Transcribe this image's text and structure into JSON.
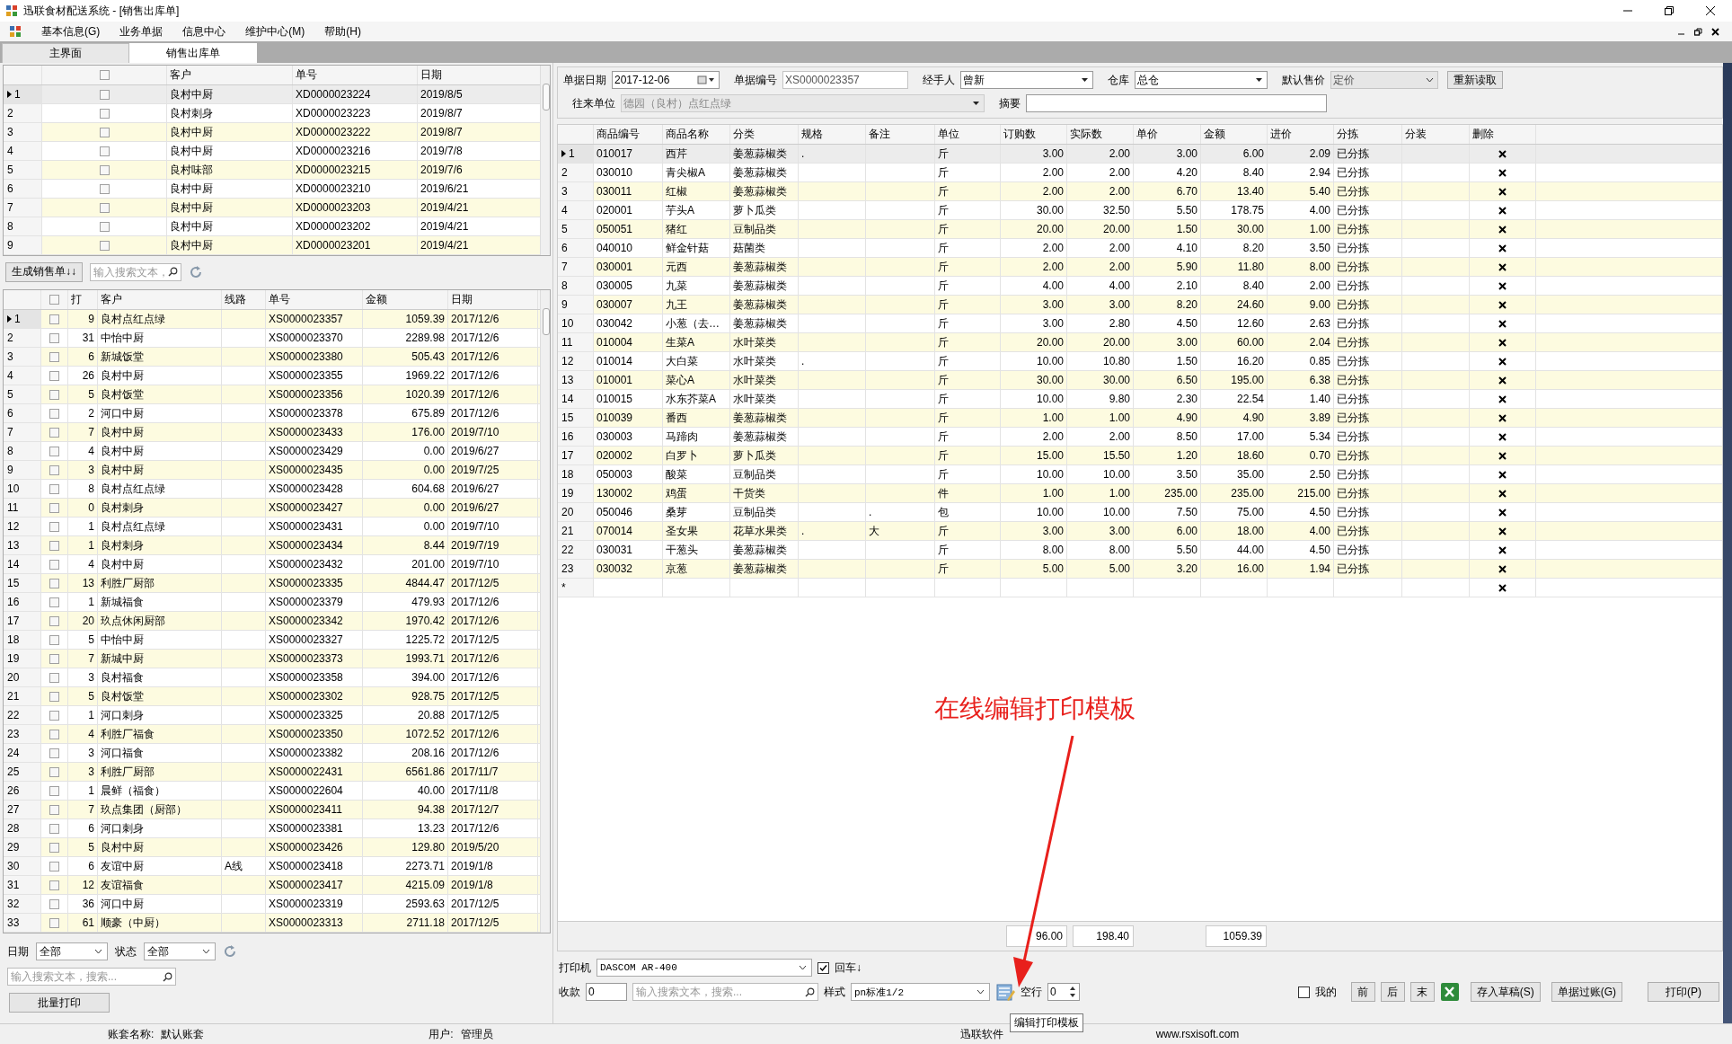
{
  "window": {
    "title": "迅联食材配送系统 - [销售出库单]"
  },
  "menu": [
    "基本信息(G)",
    "业务单据",
    "信息中心",
    "维护中心(M)",
    "帮助(H)"
  ],
  "tabs": [
    {
      "label": "主界面",
      "selected": false
    },
    {
      "label": "销售出库单",
      "selected": true
    }
  ],
  "orders_table": {
    "header_checked": false,
    "columns": [
      "客户",
      "单号",
      "日期"
    ],
    "rows": [
      {
        "no": "1",
        "current": true,
        "checked": false,
        "customer": "良村中厨",
        "number": "XD0000023224",
        "date": "2019/8/5"
      },
      {
        "no": "2",
        "current": false,
        "checked": false,
        "customer": "良村刺身",
        "number": "XD0000023223",
        "date": "2019/8/7"
      },
      {
        "no": "3",
        "current": false,
        "checked": false,
        "customer": "良村中厨",
        "number": "XD0000023222",
        "date": "2019/8/7"
      },
      {
        "no": "4",
        "current": false,
        "checked": false,
        "customer": "良村中厨",
        "number": "XD0000023216",
        "date": "2019/7/8"
      },
      {
        "no": "5",
        "current": false,
        "checked": false,
        "customer": "良村味部",
        "number": "XD0000023215",
        "date": "2019/7/6"
      },
      {
        "no": "6",
        "current": false,
        "checked": false,
        "customer": "良村中厨",
        "number": "XD0000023210",
        "date": "2019/6/21"
      },
      {
        "no": "7",
        "current": false,
        "checked": false,
        "customer": "良村中厨",
        "number": "XD0000023203",
        "date": "2019/4/21"
      },
      {
        "no": "8",
        "current": false,
        "checked": false,
        "customer": "良村中厨",
        "number": "XD0000023202",
        "date": "2019/4/21"
      },
      {
        "no": "9",
        "current": false,
        "checked": false,
        "customer": "良村中厨",
        "number": "XD0000023201",
        "date": "2019/4/21"
      }
    ]
  },
  "generate_button": "生成销售单↓↓",
  "top_search": {
    "placeholder": "输入搜索文本，"
  },
  "sales_table": {
    "header_checked": false,
    "columns": [
      "打",
      "客户",
      "线路",
      "单号",
      "金额",
      "日期"
    ],
    "rows": [
      {
        "no": "1",
        "current": true,
        "checked": false,
        "prints": "9",
        "customer": "良村点红点绿",
        "number": "XS0000023357",
        "amount": "1059.39",
        "date": "2017/12/6"
      },
      {
        "no": "2",
        "current": false,
        "checked": false,
        "prints": "31",
        "customer": "中怡中厨",
        "number": "XS0000023370",
        "amount": "2289.98",
        "date": "2017/12/6"
      },
      {
        "no": "3",
        "current": false,
        "checked": false,
        "prints": "6",
        "customer": "新城饭堂",
        "number": "XS0000023380",
        "amount": "505.43",
        "date": "2017/12/6"
      },
      {
        "no": "4",
        "current": false,
        "checked": false,
        "prints": "26",
        "customer": "良村中厨",
        "number": "XS0000023355",
        "amount": "1969.22",
        "date": "2017/12/6"
      },
      {
        "no": "5",
        "current": false,
        "checked": false,
        "prints": "5",
        "customer": "良村饭堂",
        "number": "XS0000023356",
        "amount": "1020.39",
        "date": "2017/12/6"
      },
      {
        "no": "6",
        "current": false,
        "checked": false,
        "prints": "2",
        "customer": "河口中厨",
        "number": "XS0000023378",
        "amount": "675.89",
        "date": "2017/12/6"
      },
      {
        "no": "7",
        "current": false,
        "checked": false,
        "prints": "7",
        "customer": "良村中厨",
        "number": "XS0000023433",
        "amount": "176.00",
        "date": "2019/7/10"
      },
      {
        "no": "8",
        "current": false,
        "checked": false,
        "prints": "4",
        "customer": "良村中厨",
        "number": "XS0000023429",
        "amount": "0.00",
        "date": "2019/6/27"
      },
      {
        "no": "9",
        "current": false,
        "checked": false,
        "prints": "3",
        "customer": "良村中厨",
        "number": "XS0000023435",
        "amount": "0.00",
        "date": "2019/7/25"
      },
      {
        "no": "10",
        "current": false,
        "checked": false,
        "prints": "8",
        "customer": "良村点红点绿",
        "number": "XS0000023428",
        "amount": "604.68",
        "date": "2019/6/27"
      },
      {
        "no": "11",
        "current": false,
        "checked": false,
        "prints": "0",
        "customer": "良村刺身",
        "number": "XS0000023427",
        "amount": "0.00",
        "date": "2019/6/27"
      },
      {
        "no": "12",
        "current": false,
        "checked": false,
        "prints": "1",
        "customer": "良村点红点绿",
        "number": "XS0000023431",
        "amount": "0.00",
        "date": "2019/7/10"
      },
      {
        "no": "13",
        "current": false,
        "checked": false,
        "prints": "1",
        "customer": "良村刺身",
        "number": "XS0000023434",
        "amount": "8.44",
        "date": "2019/7/19"
      },
      {
        "no": "14",
        "current": false,
        "checked": false,
        "prints": "4",
        "customer": "良村中厨",
        "number": "XS0000023432",
        "amount": "201.00",
        "date": "2019/7/10"
      },
      {
        "no": "15",
        "current": false,
        "checked": false,
        "prints": "13",
        "customer": "利胜厂厨部",
        "number": "XS0000023335",
        "amount": "4844.47",
        "date": "2017/12/5"
      },
      {
        "no": "16",
        "current": false,
        "checked": false,
        "prints": "1",
        "customer": "新城福食",
        "number": "XS0000023379",
        "amount": "479.93",
        "date": "2017/12/6"
      },
      {
        "no": "17",
        "current": false,
        "checked": false,
        "prints": "20",
        "customer": "玖点休闲厨部",
        "number": "XS0000023342",
        "amount": "1970.42",
        "date": "2017/12/6"
      },
      {
        "no": "18",
        "current": false,
        "checked": false,
        "prints": "5",
        "customer": "中怡中厨",
        "number": "XS0000023327",
        "amount": "1225.72",
        "date": "2017/12/5"
      },
      {
        "no": "19",
        "current": false,
        "checked": false,
        "prints": "7",
        "customer": "新城中厨",
        "number": "XS0000023373",
        "amount": "1993.71",
        "date": "2017/12/6"
      },
      {
        "no": "20",
        "current": false,
        "checked": false,
        "prints": "3",
        "customer": "良村福食",
        "number": "XS0000023358",
        "amount": "394.00",
        "date": "2017/12/6"
      },
      {
        "no": "21",
        "current": false,
        "checked": false,
        "prints": "5",
        "customer": "良村饭堂",
        "number": "XS0000023302",
        "amount": "928.75",
        "date": "2017/12/5"
      },
      {
        "no": "22",
        "current": false,
        "checked": false,
        "prints": "1",
        "customer": "河口刺身",
        "number": "XS0000023325",
        "amount": "20.88",
        "date": "2017/12/5"
      },
      {
        "no": "23",
        "current": false,
        "checked": false,
        "prints": "4",
        "customer": "利胜厂福食",
        "number": "XS0000023350",
        "amount": "1072.52",
        "date": "2017/12/6"
      },
      {
        "no": "24",
        "current": false,
        "checked": false,
        "prints": "3",
        "customer": "河口福食",
        "number": "XS0000023382",
        "amount": "208.16",
        "date": "2017/12/6"
      },
      {
        "no": "25",
        "current": false,
        "checked": false,
        "prints": "3",
        "customer": "利胜厂厨部",
        "number": "XS0000022431",
        "amount": "6561.86",
        "date": "2017/11/7"
      },
      {
        "no": "26",
        "current": false,
        "checked": false,
        "prints": "1",
        "customer": "晨鲜（福食）",
        "number": "XS0000022604",
        "amount": "40.00",
        "date": "2017/11/8"
      },
      {
        "no": "27",
        "current": false,
        "checked": false,
        "prints": "7",
        "customer": "玖点集团（厨部）",
        "number": "XS0000023411",
        "amount": "94.38",
        "date": "2017/12/7"
      },
      {
        "no": "28",
        "current": false,
        "checked": false,
        "prints": "6",
        "customer": "河口刺身",
        "number": "XS0000023381",
        "amount": "13.23",
        "date": "2017/12/6"
      },
      {
        "no": "29",
        "current": false,
        "checked": false,
        "prints": "5",
        "customer": "良村中厨",
        "number": "XS0000023426",
        "amount": "129.80",
        "date": "2019/5/20"
      },
      {
        "no": "30",
        "current": false,
        "checked": false,
        "prints": "6",
        "customer": "友谊中厨",
        "route": "A线",
        "number": "XS0000023418",
        "amount": "2273.71",
        "date": "2019/1/8"
      },
      {
        "no": "31",
        "current": false,
        "checked": false,
        "prints": "12",
        "customer": "友谊福食",
        "number": "XS0000023417",
        "amount": "4215.09",
        "date": "2019/1/8"
      },
      {
        "no": "32",
        "current": false,
        "checked": false,
        "prints": "36",
        "customer": "河口中厨",
        "number": "XS0000023319",
        "amount": "2593.63",
        "date": "2017/12/5"
      },
      {
        "no": "33",
        "current": false,
        "checked": false,
        "prints": "61",
        "customer": "顺豪（中厨）",
        "number": "XS0000023313",
        "amount": "2711.18",
        "date": "2017/12/5"
      }
    ]
  },
  "filters": {
    "date_label": "日期",
    "date_value": "全部",
    "status_label": "状态",
    "status_value": "全部",
    "search_placeholder": "输入搜索文本，搜索...",
    "batch_print": "批量打印"
  },
  "form": {
    "fields": [
      {
        "kind": "date",
        "label": "单据日期",
        "value": "2017-12-06",
        "disabled": false,
        "readonly": false
      },
      {
        "kind": "text",
        "label": "单据编号",
        "value": "XS0000023357",
        "disabled": false,
        "readonly": true
      },
      {
        "kind": "combo",
        "label": "经手人",
        "value": "曾新",
        "disabled": false,
        "readonly": false
      },
      {
        "kind": "combo",
        "label": "仓库",
        "value": "总仓",
        "disabled": false,
        "readonly": false
      },
      {
        "kind": "combo",
        "label": "默认售价",
        "value": "定价",
        "disabled": false,
        "readonly": true
      },
      {
        "kind": "combo",
        "label": "往来单位",
        "value": "德园（良村）点红点绿",
        "disabled": true,
        "readonly": false
      },
      {
        "kind": "text",
        "label": "摘要",
        "disabled": false,
        "readonly": false
      }
    ],
    "reload_button": "重新读取"
  },
  "detail_table": {
    "columns": [
      "商品编号",
      "商品名称",
      "分类",
      "规格",
      "备注",
      "单位",
      "订购数",
      "实际数",
      "单价",
      "金额",
      "进价",
      "分拣",
      "分装",
      "删除"
    ],
    "rows": [
      {
        "no": "1",
        "current": true,
        "code": "010017",
        "name": "西芹",
        "category": "姜葱蒜椒类",
        "spec": ".",
        "unit": "斤",
        "ordered": "3.00",
        "actual": "2.00",
        "price": "3.00",
        "amount": "6.00",
        "cost": "2.09",
        "sort": "已分拣"
      },
      {
        "no": "2",
        "current": false,
        "code": "030010",
        "name": "青尖椒A",
        "category": "姜葱蒜椒类",
        "unit": "斤",
        "ordered": "2.00",
        "actual": "2.00",
        "price": "4.20",
        "amount": "8.40",
        "cost": "2.94",
        "sort": "已分拣"
      },
      {
        "no": "3",
        "current": false,
        "code": "030011",
        "name": "红椒",
        "category": "姜葱蒜椒类",
        "unit": "斤",
        "ordered": "2.00",
        "actual": "2.00",
        "price": "6.70",
        "amount": "13.40",
        "cost": "5.40",
        "sort": "已分拣"
      },
      {
        "no": "4",
        "current": false,
        "code": "020001",
        "name": "芋头A",
        "category": "萝卜瓜类",
        "unit": "斤",
        "ordered": "30.00",
        "actual": "32.50",
        "price": "5.50",
        "amount": "178.75",
        "cost": "4.00",
        "sort": "已分拣"
      },
      {
        "no": "5",
        "current": false,
        "code": "050051",
        "name": "猪红",
        "category": "豆制品类",
        "unit": "斤",
        "ordered": "20.00",
        "actual": "20.00",
        "price": "1.50",
        "amount": "30.00",
        "cost": "1.00",
        "sort": "已分拣"
      },
      {
        "no": "6",
        "current": false,
        "code": "040010",
        "name": "鲜金针菇",
        "category": "菇菌类",
        "unit": "斤",
        "ordered": "2.00",
        "actual": "2.00",
        "price": "4.10",
        "amount": "8.20",
        "cost": "3.50",
        "sort": "已分拣"
      },
      {
        "no": "7",
        "current": false,
        "code": "030001",
        "name": "元西",
        "category": "姜葱蒜椒类",
        "unit": "斤",
        "ordered": "2.00",
        "actual": "2.00",
        "price": "5.90",
        "amount": "11.80",
        "cost": "8.00",
        "sort": "已分拣"
      },
      {
        "no": "8",
        "current": false,
        "code": "030005",
        "name": "九菜",
        "category": "姜葱蒜椒类",
        "unit": "斤",
        "ordered": "4.00",
        "actual": "4.00",
        "price": "2.10",
        "amount": "8.40",
        "cost": "2.00",
        "sort": "已分拣"
      },
      {
        "no": "9",
        "current": false,
        "code": "030007",
        "name": "九王",
        "category": "姜葱蒜椒类",
        "unit": "斤",
        "ordered": "3.00",
        "actual": "3.00",
        "price": "8.20",
        "amount": "24.60",
        "cost": "9.00",
        "sort": "已分拣"
      },
      {
        "no": "10",
        "current": false,
        "code": "030042",
        "name": "小葱（去…",
        "category": "姜葱蒜椒类",
        "unit": "斤",
        "ordered": "3.00",
        "actual": "2.80",
        "price": "4.50",
        "amount": "12.60",
        "cost": "2.63",
        "sort": "已分拣"
      },
      {
        "no": "11",
        "current": false,
        "code": "010004",
        "name": "生菜A",
        "category": "水叶菜类",
        "unit": "斤",
        "ordered": "20.00",
        "actual": "20.00",
        "price": "3.00",
        "amount": "60.00",
        "cost": "2.04",
        "sort": "已分拣"
      },
      {
        "no": "12",
        "current": false,
        "code": "010014",
        "name": "大白菜",
        "category": "水叶菜类",
        "spec": ".",
        "unit": "斤",
        "ordered": "10.00",
        "actual": "10.80",
        "price": "1.50",
        "amount": "16.20",
        "cost": "0.85",
        "sort": "已分拣"
      },
      {
        "no": "13",
        "current": false,
        "code": "010001",
        "name": "菜心A",
        "category": "水叶菜类",
        "unit": "斤",
        "ordered": "30.00",
        "actual": "30.00",
        "price": "6.50",
        "amount": "195.00",
        "cost": "6.38",
        "sort": "已分拣"
      },
      {
        "no": "14",
        "current": false,
        "code": "010015",
        "name": "水东芥菜A",
        "category": "水叶菜类",
        "unit": "斤",
        "ordered": "10.00",
        "actual": "9.80",
        "price": "2.30",
        "amount": "22.54",
        "cost": "1.40",
        "sort": "已分拣"
      },
      {
        "no": "15",
        "current": false,
        "code": "010039",
        "name": "番西",
        "category": "姜葱蒜椒类",
        "unit": "斤",
        "ordered": "1.00",
        "actual": "1.00",
        "price": "4.90",
        "amount": "4.90",
        "cost": "3.89",
        "sort": "已分拣"
      },
      {
        "no": "16",
        "current": false,
        "code": "030003",
        "name": "马蹄肉",
        "category": "姜葱蒜椒类",
        "unit": "斤",
        "ordered": "2.00",
        "actual": "2.00",
        "price": "8.50",
        "amount": "17.00",
        "cost": "5.34",
        "sort": "已分拣"
      },
      {
        "no": "17",
        "current": false,
        "code": "020002",
        "name": "白罗卜",
        "category": "萝卜瓜类",
        "unit": "斤",
        "ordered": "15.00",
        "actual": "15.50",
        "price": "1.20",
        "amount": "18.60",
        "cost": "0.70",
        "sort": "已分拣"
      },
      {
        "no": "18",
        "current": false,
        "code": "050003",
        "name": "酸菜",
        "category": "豆制品类",
        "unit": "斤",
        "ordered": "10.00",
        "actual": "10.00",
        "price": "3.50",
        "amount": "35.00",
        "cost": "2.50",
        "sort": "已分拣"
      },
      {
        "no": "19",
        "current": false,
        "code": "130002",
        "name": "鸡蛋",
        "category": "干货类",
        "unit": "件",
        "ordered": "1.00",
        "actual": "1.00",
        "price": "235.00",
        "amount": "235.00",
        "cost": "215.00",
        "sort": "已分拣"
      },
      {
        "no": "20",
        "current": false,
        "code": "050046",
        "name": "桑芽",
        "category": "豆制品类",
        "note": ".",
        "unit": "包",
        "ordered": "10.00",
        "actual": "10.00",
        "price": "7.50",
        "amount": "75.00",
        "cost": "4.50",
        "sort": "已分拣"
      },
      {
        "no": "21",
        "current": false,
        "code": "070014",
        "name": "圣女果",
        "category": "花草水果类",
        "spec": ".",
        "note": "大",
        "unit": "斤",
        "ordered": "3.00",
        "actual": "3.00",
        "price": "6.00",
        "amount": "18.00",
        "cost": "4.00",
        "sort": "已分拣"
      },
      {
        "no": "22",
        "current": false,
        "code": "030031",
        "name": "干葱头",
        "category": "姜葱蒜椒类",
        "unit": "斤",
        "ordered": "8.00",
        "actual": "8.00",
        "price": "5.50",
        "amount": "44.00",
        "cost": "4.50",
        "sort": "已分拣"
      },
      {
        "no": "23",
        "current": false,
        "code": "030032",
        "name": "京葱",
        "category": "姜葱蒜椒类",
        "unit": "斤",
        "ordered": "5.00",
        "actual": "5.00",
        "price": "3.20",
        "amount": "16.00",
        "cost": "1.94",
        "sort": "已分拣"
      }
    ],
    "new_row_marker": "*",
    "totals": {
      "ordered": "96.00",
      "actual": "198.40",
      "amount": "1059.39"
    }
  },
  "print_panel": {
    "printer_label": "打印机",
    "printer": "DASCOM AR-400",
    "enter_down": {
      "label": "回车↓",
      "checked": true
    },
    "payment_label": "收款",
    "payment": "0",
    "search_placeholder": "输入搜索文本，搜索...",
    "style_label": "样式",
    "style": "pn标准1/2",
    "tooltip": "编辑打印模板",
    "blank_label": "空行",
    "blank": "0",
    "mine": {
      "label": "我的",
      "checked": false
    },
    "nav_buttons": [
      "前",
      "后",
      "末"
    ],
    "buttons": [
      "存入草稿(S)",
      "单据过账(G)",
      "打印(P)"
    ]
  },
  "status_bar": {
    "account_label": "账套名称:",
    "account": "默认账套",
    "user_label": "用户:",
    "user": "管理员",
    "company": "迅联软件",
    "website": "www.rsxisoft.com"
  },
  "annotation": {
    "text": "在线编辑打印模板"
  }
}
